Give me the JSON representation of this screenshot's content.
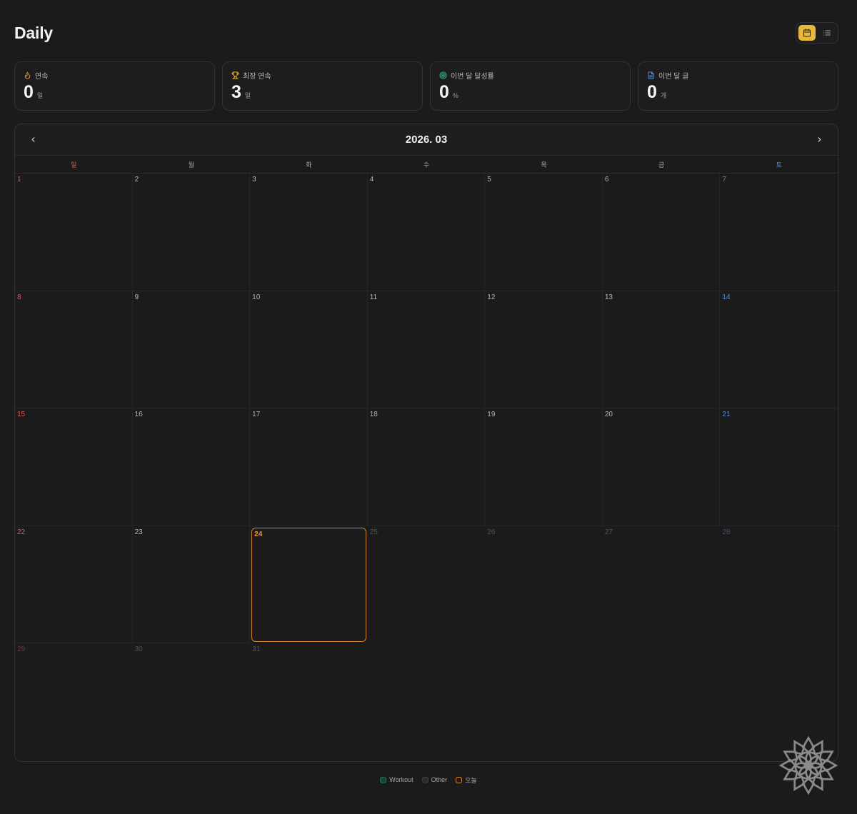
{
  "header": {
    "title": "Daily"
  },
  "view_toggle": {
    "calendar_icon": "calendar-icon",
    "list_icon": "list-icon",
    "active": "calendar"
  },
  "stats": [
    {
      "id": "streak",
      "icon": "flame-icon",
      "label": "연속",
      "value": "0",
      "unit": "일",
      "icon_color": "#e8902f"
    },
    {
      "id": "best",
      "icon": "trophy-icon",
      "label": "최장 연속",
      "value": "3",
      "unit": "일",
      "icon_color": "#e6b93a"
    },
    {
      "id": "rate",
      "icon": "target-icon",
      "label": "이번 달 달성률",
      "value": "0",
      "unit": "%",
      "icon_color": "#2bb48a"
    },
    {
      "id": "posts",
      "icon": "document-icon",
      "label": "이번 달 글",
      "value": "0",
      "unit": "개",
      "icon_color": "#4f8fe3"
    }
  ],
  "calendar": {
    "month_label": "2026. 03",
    "weekdays": [
      "일",
      "월",
      "화",
      "수",
      "목",
      "금",
      "토"
    ],
    "days": [
      "1",
      "2",
      "3",
      "4",
      "5",
      "6",
      "7",
      "8",
      "9",
      "10",
      "11",
      "12",
      "13",
      "14",
      "15",
      "16",
      "17",
      "18",
      "19",
      "20",
      "21",
      "22",
      "23",
      "24",
      "25",
      "26",
      "27",
      "28",
      "29",
      "30",
      "31",
      "",
      "",
      "",
      ""
    ],
    "today": "24"
  },
  "legend": [
    {
      "label": "Workout",
      "swatch": "workout"
    },
    {
      "label": "Other",
      "swatch": "other"
    },
    {
      "label": "오늘",
      "swatch": "today"
    }
  ],
  "colors": {
    "accent": "#e6b93a",
    "today_border": "#d9862f",
    "sunday": "#e2585a",
    "saturday": "#4f8fe3",
    "workout": "#16453a"
  }
}
